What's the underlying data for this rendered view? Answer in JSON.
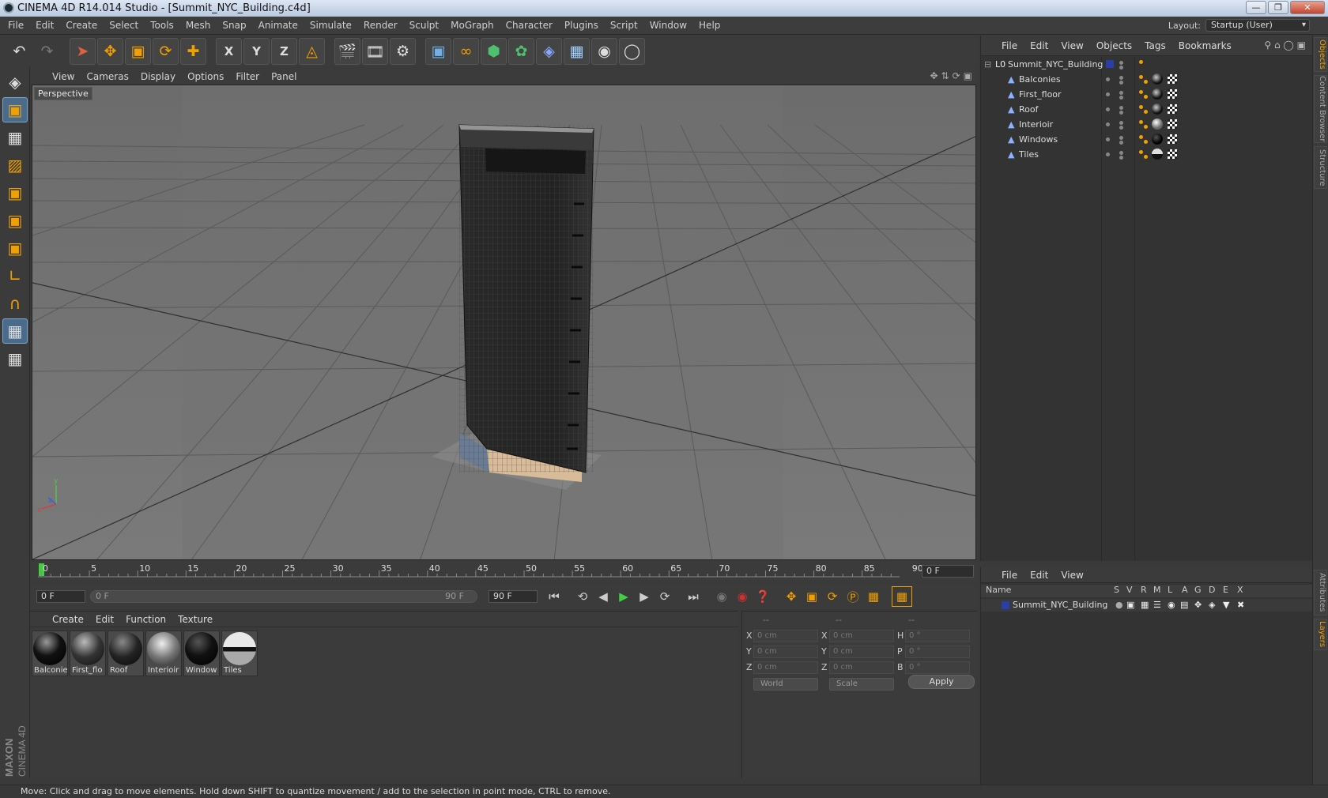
{
  "window": {
    "title": "CINEMA 4D R14.014 Studio - [Summit_NYC_Building.c4d]",
    "controls": [
      "minimize",
      "restore",
      "close"
    ]
  },
  "menubar": {
    "items": [
      "File",
      "Edit",
      "Create",
      "Select",
      "Tools",
      "Mesh",
      "Snap",
      "Animate",
      "Simulate",
      "Render",
      "Sculpt",
      "MoGraph",
      "Character",
      "Plugins",
      "Script",
      "Window",
      "Help"
    ],
    "layout_label": "Layout:",
    "layout_value": "Startup (User)"
  },
  "toolbar": {
    "icons": [
      "undo-icon",
      "redo-icon",
      "live-selection-icon",
      "move-icon",
      "scale-icon",
      "rotate-icon",
      "add-icon",
      "x-axis-icon",
      "y-axis-icon",
      "z-axis-icon",
      "world-coordinates-icon",
      "render-view-icon",
      "render-picture-viewer-icon",
      "edit-render-settings-icon",
      "cube-icon",
      "spline-icon",
      "nurbs-icon",
      "array-icon",
      "deformer-icon",
      "floor-icon",
      "camera-icon",
      "light-icon"
    ],
    "axis_labels": [
      "X",
      "Y",
      "Z"
    ]
  },
  "left_tools": [
    "model-mode-icon",
    "object-mode-icon",
    "texture-mode-icon",
    "workplane-icon",
    "points-mode-icon",
    "edges-mode-icon",
    "polygons-mode-icon",
    "axis-mode-icon",
    "magnet-icon",
    "snap-icon",
    "lock-workplane-icon"
  ],
  "brand": {
    "line1": "MAXON",
    "line2": "CINEMA 4D"
  },
  "viewport": {
    "menu": [
      "View",
      "Cameras",
      "Display",
      "Options",
      "Filter",
      "Panel"
    ],
    "label": "Perspective"
  },
  "timeline": {
    "ticks": [
      "0",
      "5",
      "10",
      "15",
      "20",
      "25",
      "30",
      "35",
      "40",
      "45",
      "50",
      "55",
      "60",
      "65",
      "70",
      "75",
      "80",
      "85",
      "90"
    ],
    "current": "0 F"
  },
  "playback": {
    "start": "0 F",
    "range_start": "0 F",
    "range_end": "90 F",
    "end": "90 F"
  },
  "materials": {
    "menu": [
      "Create",
      "Edit",
      "Function",
      "Texture"
    ],
    "items": [
      {
        "label": "Balconie"
      },
      {
        "label": "First_flo"
      },
      {
        "label": "Roof"
      },
      {
        "label": "Interioir"
      },
      {
        "label": "Window"
      },
      {
        "label": "Tiles"
      }
    ]
  },
  "coordinates": {
    "headers": [
      "--",
      "--",
      "--"
    ],
    "rows": [
      {
        "a": "X",
        "av": "0 cm",
        "b": "X",
        "bv": "0 cm",
        "c": "H",
        "cv": "0 °"
      },
      {
        "a": "Y",
        "av": "0 cm",
        "b": "Y",
        "bv": "0 cm",
        "c": "P",
        "cv": "0 °"
      },
      {
        "a": "Z",
        "av": "0 cm",
        "b": "Z",
        "bv": "0 cm",
        "c": "B",
        "cv": "0 °"
      }
    ],
    "mode": "World",
    "transform": "Scale",
    "apply": "Apply"
  },
  "objects": {
    "menu": [
      "File",
      "Edit",
      "View",
      "Objects",
      "Tags",
      "Bookmarks"
    ],
    "root": "Summit_NYC_Building",
    "children": [
      "Balconies",
      "First_floor",
      "Roof",
      "Interioir",
      "Windows",
      "Tiles"
    ]
  },
  "layers": {
    "menu": [
      "File",
      "Edit",
      "View"
    ],
    "columns": [
      "Name",
      "S",
      "V",
      "R",
      "M",
      "L",
      "A",
      "G",
      "D",
      "E",
      "X"
    ],
    "row": "Summit_NYC_Building"
  },
  "side_tabs": {
    "objects": "Objects",
    "content": "Content Browser",
    "structure": "Structure",
    "attributes": "Attributes",
    "layers": "Layers"
  },
  "status": "Move: Click and drag to move elements. Hold down SHIFT to quantize movement / add to the selection in point mode, CTRL to remove.",
  "colors": {
    "accent": "#f0a000",
    "selected": "#4a6b8c",
    "layer_blue": "#2a3ea8"
  }
}
